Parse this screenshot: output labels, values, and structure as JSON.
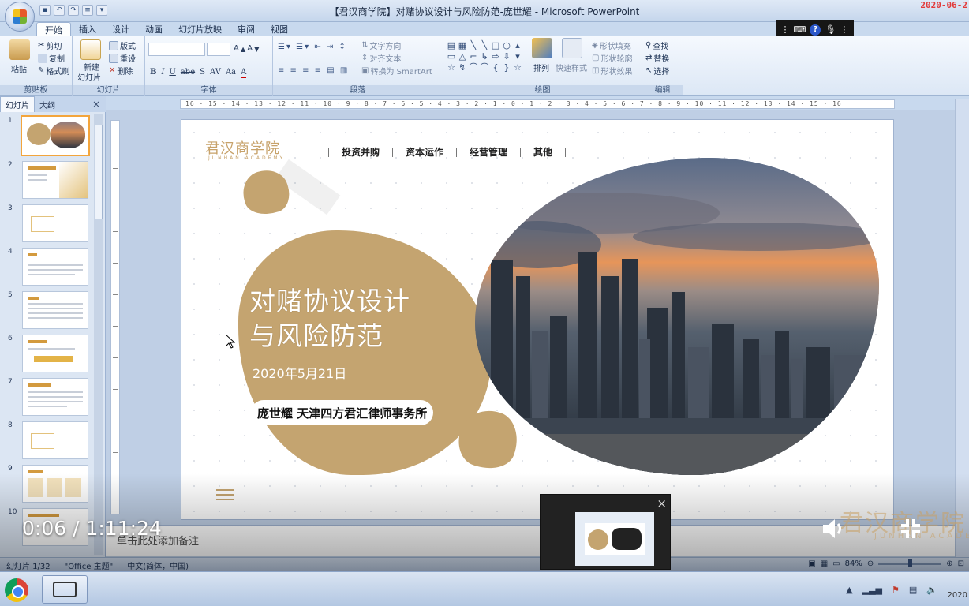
{
  "window": {
    "title": "【君汉商学院】对赌协议设计与风险防范-庞世耀 - Microsoft PowerPoint",
    "rec_date": "2020-06-2",
    "controls": [
      "一",
      "□",
      "×"
    ]
  },
  "ribbon": {
    "tabs": [
      "开始",
      "插入",
      "设计",
      "动画",
      "幻灯片放映",
      "审阅",
      "视图"
    ],
    "groups": {
      "clipboard": {
        "label": "剪贴板",
        "paste": "粘贴",
        "cut": "剪切",
        "copy": "复制",
        "painter": "格式刷"
      },
      "slides": {
        "label": "幻灯片",
        "new_slide": "新建",
        "new_slide2": "幻灯片",
        "layout": "版式",
        "reset": "重设",
        "delete": "删除"
      },
      "font": {
        "label": "字体",
        "bold": "B",
        "italic": "I",
        "underline": "U",
        "strike": "abe",
        "shadow": "S",
        "spacing": "AV",
        "case": "Aa",
        "color": "A"
      },
      "paragraph": {
        "label": "段落",
        "text_dir": "文字方向",
        "align_text": "对齐文本",
        "smartart": "转换为 SmartArt"
      },
      "drawing": {
        "label": "绘图",
        "arrange": "排列",
        "quick_styles": "快速样式",
        "fill": "形状填充",
        "outline": "形状轮廓",
        "effects": "形状效果"
      },
      "editing": {
        "label": "编辑",
        "find": "查找",
        "replace": "替换",
        "select": "选择"
      }
    }
  },
  "ime": {
    "help": "?"
  },
  "left_panel": {
    "tabs": [
      "幻灯片",
      "大纲"
    ],
    "close": "×",
    "slide_numbers": [
      "1",
      "2",
      "3",
      "4",
      "5",
      "6",
      "7",
      "8",
      "9",
      "10"
    ]
  },
  "ruler": {
    "labels": "16 · 15 · 14 · 13 · 12 · 11 · 10 · 9 · 8 · 7 · 6 · 5 · 4 · 3 · 2 · 1 · 0 · 1 · 2 · 3 · 4 · 5 · 6 · 7 · 8 · 9 · 10 · 11 · 12 · 13 · 14 · 15 · 16"
  },
  "slide": {
    "brand": "君汉商学院",
    "brand_sub": "JUNHAN ACADEMY",
    "nav": [
      "投资并购",
      "资本运作",
      "经营管理",
      "其他"
    ],
    "title_line1": "对赌协议设计",
    "title_line2": "与风险防范",
    "date": "2020年5月21日",
    "author": "庞世耀 天津四方君汇律师事务所"
  },
  "notes": {
    "placeholder": "单击此处添加备注"
  },
  "status": {
    "slide_count": "幻灯片 1/32",
    "theme": "\"Office 主题\"",
    "language": "中文(简体，中国)",
    "zoom": "84%"
  },
  "video": {
    "timecode": "0:06 / 1:11:24",
    "watermark": "君汉商学院",
    "watermark_sub": "JUNHAN ACADEMY",
    "preview_close": "×"
  },
  "taskbar": {
    "clock": "2020"
  }
}
